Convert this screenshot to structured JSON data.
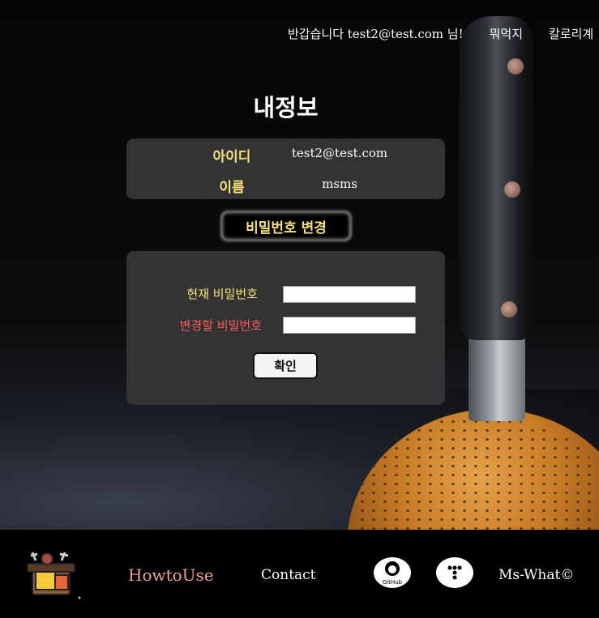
{
  "topnav": {
    "greeting": "반갑습니다 test2@test.com 님!",
    "items": [
      "뭐먹지",
      "칼로리계"
    ]
  },
  "profile": {
    "title": "내정보",
    "id_label": "아이디",
    "id_value": "test2@test.com",
    "name_label": "이름",
    "name_value": "msms",
    "change_password_button": "비밀번호 변경"
  },
  "password_form": {
    "current_label": "현재 비밀번호",
    "current_value": "",
    "new_label": "변경할 비밀번호",
    "new_value": "",
    "confirm_button": "확인"
  },
  "footer": {
    "howto": "HowtoUse",
    "contact": "Contact",
    "github_icon": "github-icon",
    "github_text": "GitHub",
    "tistory_icon": "tistory-icon",
    "copyright": "Ms-What©"
  },
  "colors": {
    "label_yellow": "#f5e27a",
    "label_red": "#ff5a5a",
    "card_gray": "#333333",
    "howto_pink": "#f0a0a0"
  }
}
